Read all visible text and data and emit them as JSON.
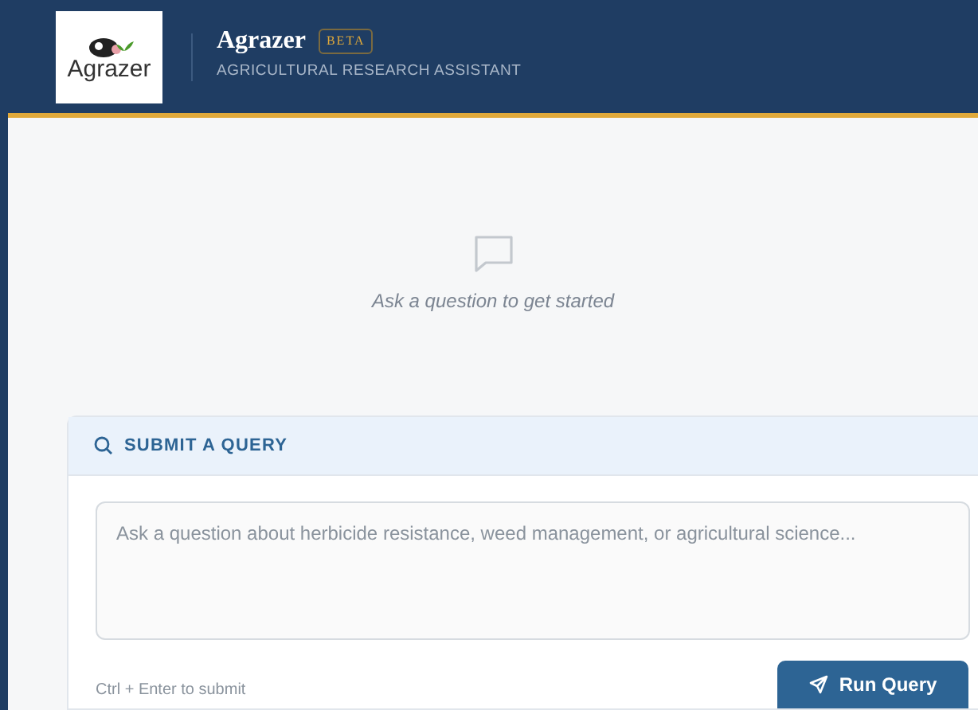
{
  "header": {
    "logo_text": "Agrazer",
    "title": "Agrazer",
    "badge": "BETA",
    "subtitle": "AGRICULTURAL RESEARCH ASSISTANT"
  },
  "empty_state": {
    "message": "Ask a question to get started"
  },
  "query_panel": {
    "heading": "SUBMIT A QUERY",
    "placeholder": "Ask a question about herbicide resistance, weed management, or agricultural science...",
    "hint": "Ctrl + Enter to submit",
    "button": "Run Query"
  }
}
